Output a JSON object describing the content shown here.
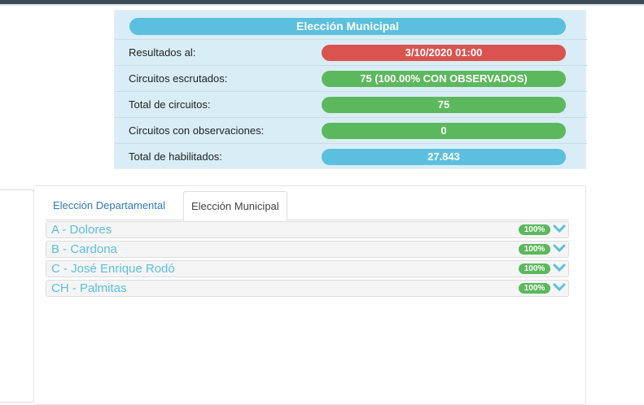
{
  "summary": {
    "title": "Elección Municipal",
    "rows": [
      {
        "label": "Resultados al:",
        "value": "3/10/2020 01:00",
        "color": "#d9534f"
      },
      {
        "label": "Circuitos escrutados:",
        "value": "75 (100.00% CON OBSERVADOS)",
        "color": "#5cb85c"
      },
      {
        "label": "Total de circuitos:",
        "value": "75",
        "color": "#5cb85c"
      },
      {
        "label": "Circuitos con observaciones:",
        "value": "0",
        "color": "#5cb85c"
      },
      {
        "label": "Total de habilitados:",
        "value": "27.843",
        "color": "#5bc0de"
      }
    ]
  },
  "tabs": [
    {
      "label": "Elección Departamental",
      "active": false
    },
    {
      "label": "Elección Municipal",
      "active": true
    }
  ],
  "municipios": [
    {
      "label": "A - Dolores",
      "badge": "100%",
      "icon": "chevron-down-icon"
    },
    {
      "label": "B - Cardona",
      "badge": "100%",
      "icon": "chevron-down-icon"
    },
    {
      "label": "C - José Enrique Rodó",
      "badge": "100%",
      "icon": "chevron-down-icon"
    },
    {
      "label": "CH - Palmitas",
      "badge": "100%",
      "icon": "chevron-down-icon"
    }
  ],
  "colors": {
    "info": "#5bc0de",
    "success": "#5cb85c",
    "danger": "#d9534f",
    "link": "#337ab7"
  }
}
